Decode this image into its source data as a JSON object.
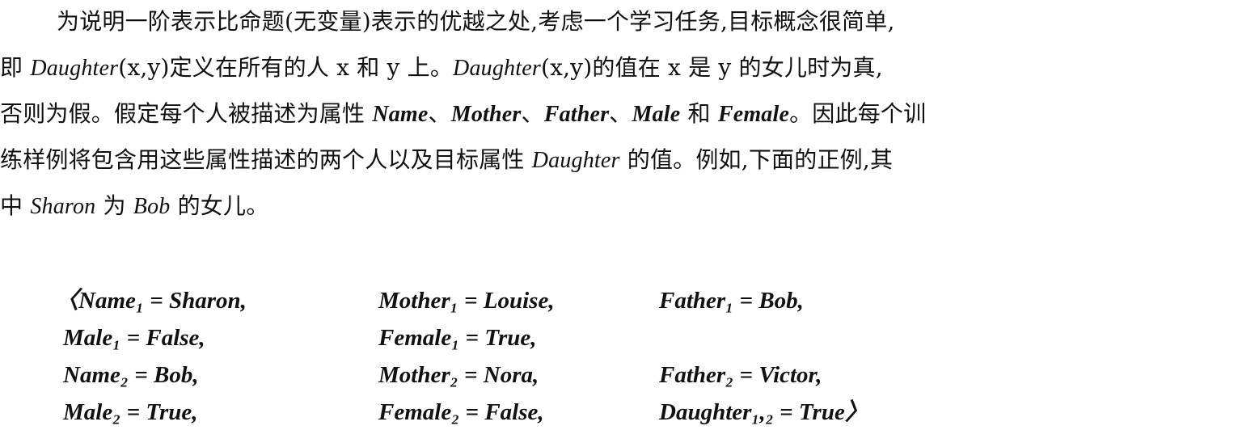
{
  "paragraph": {
    "line1": "为说明一阶表示比命题(无变量)表示的优越之处,考虑一个学习任务,目标概念很简单,",
    "line2_a": "即 ",
    "line2_b": "Daughter",
    "line2_c": "(x,y)定义在所有的人 x 和 y 上。",
    "line2_d": "Daughter",
    "line2_e": "(x,y)的值在 x 是 y 的女儿时为真,",
    "line3_a": "否则为假。假定每个人被描述为属性 ",
    "line3_b": "Name",
    "line3_c": "、",
    "line3_d": "Mother",
    "line3_e": "、",
    "line3_f": "Father",
    "line3_g": "、",
    "line3_h": "Male",
    "line3_i": " 和 ",
    "line3_j": "Female",
    "line3_k": "。因此每个训",
    "line4_a": "练样例将包含用这些属性描述的两个人以及目标属性 ",
    "line4_b": "Daughter",
    "line4_c": " 的值。例如,下面的正例,其",
    "line5_a": "中 ",
    "line5_b": "Sharon",
    "line5_c": " 为 ",
    "line5_d": "Bob",
    "line5_e": " 的女儿。"
  },
  "example": {
    "r1c1": "〈Name₁ = Sharon,",
    "r1c2": "Mother₁ = Louise,",
    "r1c3": "Father₁ = Bob,",
    "r2c1": "Male₁ = False,",
    "r2c2": "Female₁ = True,",
    "r3c1": "Name₂ = Bob,",
    "r3c2": "Mother₂ = Nora,",
    "r3c3": "Father₂ = Victor,",
    "r4c1": "Male₂ = True,",
    "r4c2": "Female₂ = False,",
    "r4c3": "Daughter₁,₂ = True〉"
  }
}
